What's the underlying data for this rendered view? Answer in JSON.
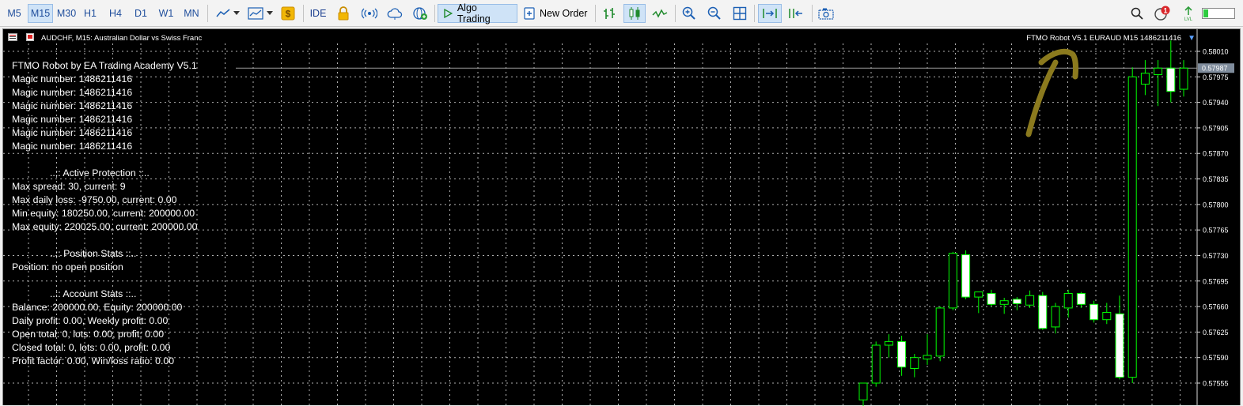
{
  "toolbar": {
    "timeframes": [
      "M5",
      "M15",
      "M30",
      "H1",
      "H4",
      "D1",
      "W1",
      "MN"
    ],
    "active_timeframe": "M15",
    "ide_label": "IDE",
    "algo_trading_label": "Algo Trading",
    "new_order_label": "New Order",
    "notification_count": "1"
  },
  "chart": {
    "symbol_title": "AUDCHF, M15:  Australian Dollar vs Swiss Franc",
    "ea_label": "FTMO Robot V5.1 EURAUD M15 1486211416",
    "current_price_label": "0.57987",
    "price_axis": [
      "0.58010",
      "0.57975",
      "0.57940",
      "0.57905",
      "0.57870",
      "0.57835",
      "0.57800",
      "0.57765",
      "0.57730",
      "0.57695",
      "0.57660",
      "0.57625",
      "0.57590",
      "0.57555"
    ]
  },
  "info_panel": {
    "title": "FTMO Robot by EA Trading Academy V5.1",
    "magic_numbers": [
      "Magic number: 1486211416",
      "Magic number: 1486211416",
      "Magic number: 1486211416",
      "Magic number: 1486211416",
      "Magic number: 1486211416",
      "Magic number: 1486211416"
    ],
    "active_protection": {
      "header": "..:: Active Protection ::..",
      "lines": [
        "Max spread: 30, current: 9",
        "Max daily loss: -9750.00, current: 0.00",
        "Min equity: 180250.00, current: 200000.00",
        "Max equity: 220025.00, current: 200000.00"
      ]
    },
    "position_stats": {
      "header": "..:: Position Stats ::..",
      "lines": [
        "Position: no open position"
      ]
    },
    "account_stats": {
      "header": "..:: Account Stats ::..",
      "lines": [
        "Balance: 200000.00, Equity: 200000.00",
        "Daily profit: 0.00, Weekly profit: 0.00",
        "Open total: 0, lots: 0.00, profit: 0.00",
        "Closed total: 0, lots: 0.00, profit: 0.00",
        "Profit factor: 0.00, Win/loss ratio: 0.00"
      ]
    }
  },
  "colors": {
    "bull": "#00ff00",
    "bear_fill": "#ffffff",
    "grid": "#b0b0b0",
    "arrow": "#8b7a1e",
    "price_tag": "#7f8c9c"
  },
  "chart_data": {
    "type": "candlestick",
    "candles": [
      {
        "o": 0.57532,
        "h": 0.57555,
        "l": 0.57505,
        "c": 0.57555
      },
      {
        "o": 0.57555,
        "h": 0.57612,
        "l": 0.5755,
        "c": 0.57607
      },
      {
        "o": 0.57607,
        "h": 0.57622,
        "l": 0.5759,
        "c": 0.57612
      },
      {
        "o": 0.57612,
        "h": 0.5762,
        "l": 0.57565,
        "c": 0.57577
      },
      {
        "o": 0.57575,
        "h": 0.57595,
        "l": 0.57563,
        "c": 0.5759
      },
      {
        "o": 0.57588,
        "h": 0.57622,
        "l": 0.5758,
        "c": 0.57593
      },
      {
        "o": 0.57592,
        "h": 0.5766,
        "l": 0.57585,
        "c": 0.57658
      },
      {
        "o": 0.57658,
        "h": 0.57735,
        "l": 0.57655,
        "c": 0.57733
      },
      {
        "o": 0.57731,
        "h": 0.57737,
        "l": 0.5767,
        "c": 0.57673
      },
      {
        "o": 0.57673,
        "h": 0.5768,
        "l": 0.57651,
        "c": 0.5768
      },
      {
        "o": 0.57678,
        "h": 0.57683,
        "l": 0.5766,
        "c": 0.57663
      },
      {
        "o": 0.57663,
        "h": 0.57672,
        "l": 0.5765,
        "c": 0.57668
      },
      {
        "o": 0.5767,
        "h": 0.57673,
        "l": 0.57655,
        "c": 0.57664
      },
      {
        "o": 0.57662,
        "h": 0.57682,
        "l": 0.57658,
        "c": 0.57675
      },
      {
        "o": 0.57675,
        "h": 0.5768,
        "l": 0.57628,
        "c": 0.5763
      },
      {
        "o": 0.57632,
        "h": 0.57665,
        "l": 0.57623,
        "c": 0.5766
      },
      {
        "o": 0.57658,
        "h": 0.57683,
        "l": 0.57645,
        "c": 0.57678
      },
      {
        "o": 0.57678,
        "h": 0.5768,
        "l": 0.57658,
        "c": 0.57663
      },
      {
        "o": 0.57663,
        "h": 0.57668,
        "l": 0.57638,
        "c": 0.57642
      },
      {
        "o": 0.57642,
        "h": 0.57665,
        "l": 0.57636,
        "c": 0.57652
      },
      {
        "o": 0.5765,
        "h": 0.57675,
        "l": 0.5756,
        "c": 0.57563
      },
      {
        "o": 0.57563,
        "h": 0.57988,
        "l": 0.57555,
        "c": 0.57975
      },
      {
        "o": 0.57965,
        "h": 0.57998,
        "l": 0.5795,
        "c": 0.5798
      },
      {
        "o": 0.57978,
        "h": 0.57998,
        "l": 0.57935,
        "c": 0.57987
      },
      {
        "o": 0.57987,
        "h": 0.58025,
        "l": 0.5794,
        "c": 0.57955
      },
      {
        "o": 0.57958,
        "h": 0.57998,
        "l": 0.57948,
        "c": 0.57987
      }
    ],
    "ylim": [
      0.57505,
      0.58042
    ]
  }
}
